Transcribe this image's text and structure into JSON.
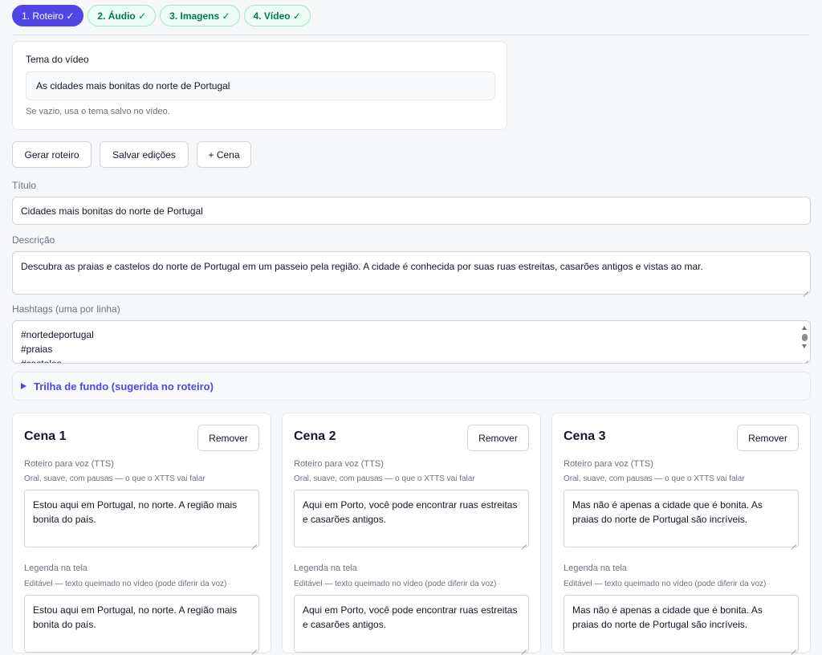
{
  "steps": [
    {
      "label": "1. Roteiro ✓"
    },
    {
      "label": "2. Áudio ✓"
    },
    {
      "label": "3. Imagens ✓"
    },
    {
      "label": "4. Vídeo ✓"
    }
  ],
  "theme": {
    "label": "Tema do vídeo",
    "value": "As cidades mais bonitas do norte de Portugal",
    "hint": "Se vazio, usa o tema salvo no vídeo."
  },
  "actions": {
    "generate": "Gerar roteiro",
    "save": "Salvar edições",
    "add_scene": "+ Cena"
  },
  "title_field": {
    "label": "Título",
    "value": "Cidades mais bonitas do norte de Portugal"
  },
  "description_field": {
    "label": "Descrição",
    "value": "Descubra as praias e castelos do norte de Portugal em um passeio pela região. A cidade é conhecida por suas ruas estreitas, casarões antigos e vistas ao mar."
  },
  "hashtags_field": {
    "label": "Hashtags (uma por linha)",
    "lines": [
      "#nortedeportugal",
      "#praias",
      "#castelos"
    ]
  },
  "music": {
    "label": "Trilha de fundo (sugerida no roteiro)"
  },
  "scenes": [
    {
      "title": "Cena 1",
      "remove": "Remover",
      "tts_label": "Roteiro para voz (TTS)",
      "tts_hint": "Oral, suave, com pausas — o que o XTTS vai falar",
      "tts_text": "Estou aqui em Portugal, no norte. A região mais bonita do país.",
      "caption_label": "Legenda na tela",
      "caption_hint": "Editável — texto queimado no vídeo (pode diferir da voz)",
      "caption_text": "Estou aqui em Portugal, no norte. A região mais bonita do país."
    },
    {
      "title": "Cena 2",
      "remove": "Remover",
      "tts_label": "Roteiro para voz (TTS)",
      "tts_hint": "Oral, suave, com pausas — o que o XTTS vai falar",
      "tts_text": "Aqui em Porto, você pode encontrar ruas estreitas e casarões antigos.",
      "caption_label": "Legenda na tela",
      "caption_hint": "Editável — texto queimado no vídeo (pode diferir da voz)",
      "caption_text": "Aqui em Porto, você pode encontrar ruas estreitas e casarões antigos."
    },
    {
      "title": "Cena 3",
      "remove": "Remover",
      "tts_label": "Roteiro para voz (TTS)",
      "tts_hint": "Oral, suave, com pausas — o que o XTTS vai falar",
      "tts_text": "Mas não é apenas a cidade que é bonita. As praias do norte de Portugal são incríveis.",
      "caption_label": "Legenda na tela",
      "caption_hint": "Editável — texto queimado no vídeo (pode diferir da voz)",
      "caption_text": "Mas não é apenas a cidade que é bonita. As praias do norte de Portugal são incríveis."
    }
  ],
  "colors": {
    "accent": "#4f46e5",
    "done_bg": "#ecfdf5",
    "done_text": "#047857"
  }
}
